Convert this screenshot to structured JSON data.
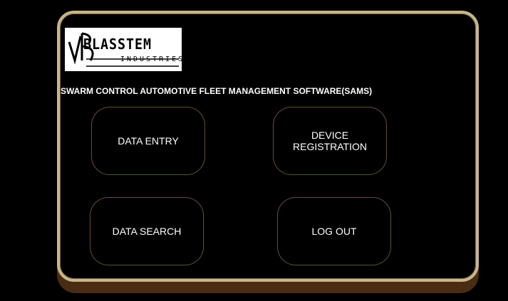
{
  "logo": {
    "brand_top": "BLASSTEM",
    "brand_bottom": "INDUSTRIES",
    "icon": "vb-logo-icon"
  },
  "header": {
    "title": "SWARM CONTROL AUTOMOTIVE FLEET MANAGEMENT SOFTWARE(SAMS)"
  },
  "menu": {
    "data_entry": "DATA ENTRY",
    "device_registration": "DEVICE REGISTRATION",
    "data_search": "DATA SEARCH",
    "log_out": "LOG OUT"
  },
  "colors": {
    "background": "#000000",
    "panel_border": "#c8b68a",
    "panel_shadow": "#4a2c12",
    "button_border": "#6b4a35",
    "text": "#ffffff"
  }
}
